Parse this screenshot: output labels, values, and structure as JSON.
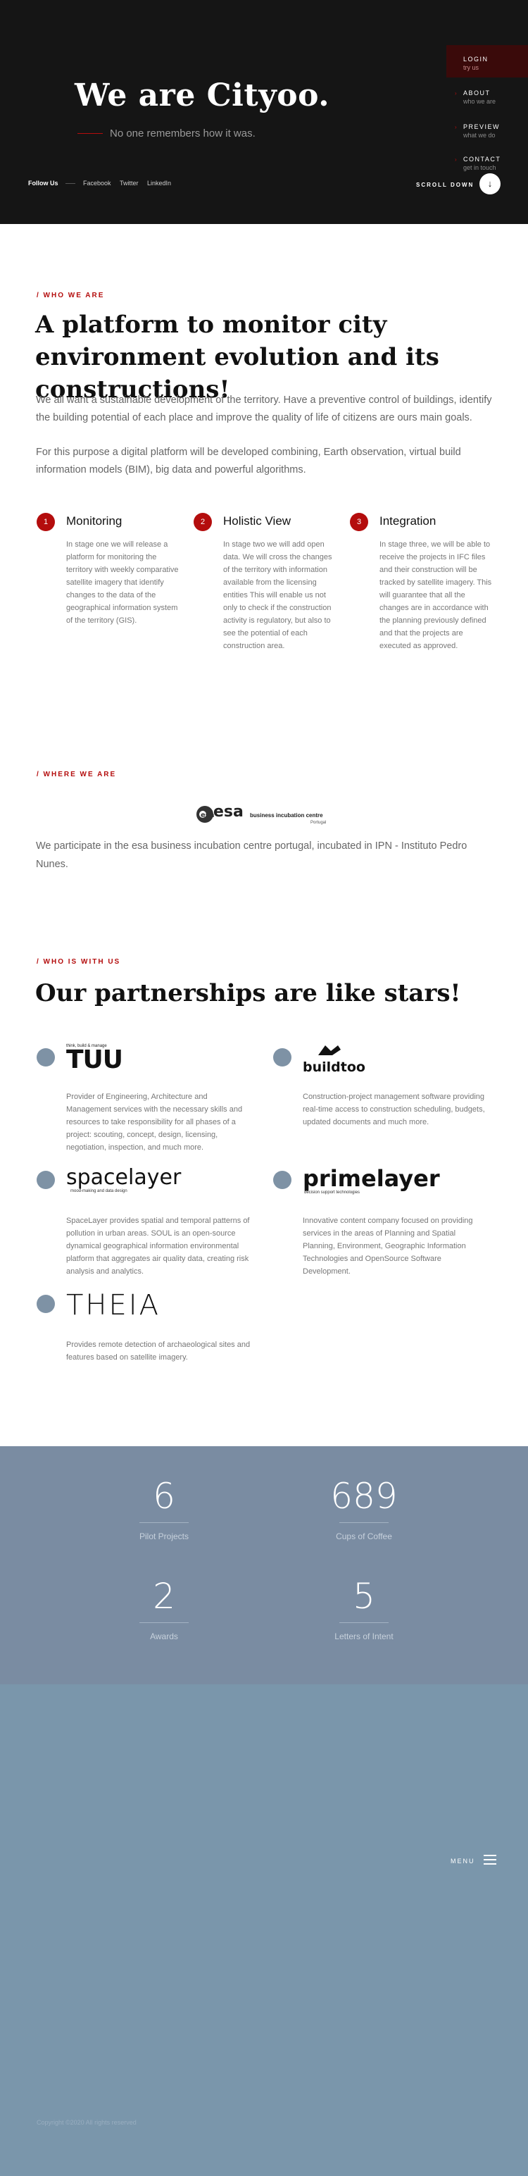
{
  "hero": {
    "title": "We are Cityoo.",
    "subtitle": "No one remembers how it was.",
    "follow_label": "Follow Us",
    "socials": [
      "Facebook",
      "Twitter",
      "LinkedIn"
    ],
    "scroll_label": "SCROLL DOWN",
    "scroll_icon": "↓"
  },
  "nav": [
    {
      "title": "LOGIN",
      "sub": "try us",
      "active": true
    },
    {
      "title": "ABOUT",
      "sub": "who we are",
      "active": false
    },
    {
      "title": "PREVIEW",
      "sub": "what we do",
      "active": false
    },
    {
      "title": "CONTACT",
      "sub": "get in touch",
      "active": false
    }
  ],
  "who": {
    "eyebrow": "/ WHO WE ARE",
    "heading": "A platform to monitor city environment evolution and its constructions!",
    "p1": "We all want a sustainable development of the territory. Have a preventive control of buildings, identify the building potential of each place and improve the quality of life of citizens are ours main goals.",
    "p2": "For this purpose a digital platform will be developed combining, Earth observation, virtual build information models (BIM), big data and powerful algorithms."
  },
  "steps": [
    {
      "num": "1",
      "title": "Monitoring",
      "text": "In stage one we will release a platform for monitoring the territory with weekly comparative satellite imagery that identify changes to the data of the geographical information system of the territory (GIS)."
    },
    {
      "num": "2",
      "title": "Holistic View",
      "text": "In stage two we will add open data. We will cross the changes of the territory with information available from the licensing entities This will enable us not only to check if the construction activity is regulatory, but also to see the potential of each construction area."
    },
    {
      "num": "3",
      "title": "Integration",
      "text": "In stage three, we will be able to receive the projects in IFC files and their construction will be tracked by satellite imagery. This will guarantee that all the changes are in accordance with the planning previously defined and that the projects are executed as approved."
    }
  ],
  "where": {
    "eyebrow": "/ WHERE WE ARE",
    "logo_main": "esa",
    "logo_sub": "business incubation centre",
    "logo_place": "Portugal",
    "text": "We participate in the esa business incubation centre portugal, incubated in IPN - Instituto Pedro Nunes."
  },
  "partners_section": {
    "eyebrow": "/ WHO IS WITH US",
    "heading": "Our partnerships are like stars!"
  },
  "partners": [
    {
      "logo": "TUU",
      "logo_caption": "think, build & manage",
      "text": "Provider of Engineering, Architecture and Management services with the necessary skills and resources to take responsibility for all phases of a project: scouting, concept, design, licensing, negotiation, inspection, and much more."
    },
    {
      "logo": "buildtoo",
      "logo_caption": "",
      "text": "Construction-project management software providing real-time access to construction scheduling, budgets, updated documents and much more."
    },
    {
      "logo": "spacelayer",
      "logo_caption": "mood-making and data design",
      "text": "SpaceLayer provides spatial and temporal patterns of pollution in urban areas. SOUL is an open-source dynamical geographical information environmental platform that aggregates air quality data, creating risk analysis and analytics."
    },
    {
      "logo": "primelayer",
      "logo_caption": "decision support technologies",
      "text": "Innovative content company focused on providing services in the areas of Planning and Spatial Planning, Environment, Geographic Information Technologies and OpenSource Software Development."
    },
    {
      "logo": "THEIA",
      "logo_caption": "",
      "text": "Provides remote detection of archaeological sites and features based on satellite imagery."
    }
  ],
  "stats": [
    {
      "num": "6",
      "label": "Pilot Projects"
    },
    {
      "num": "689",
      "label": "Cups of Coffee"
    },
    {
      "num": "2",
      "label": "Awards"
    },
    {
      "num": "5",
      "label": "Letters of Intent"
    }
  ],
  "footer": {
    "menu_label": "MENU",
    "copyright": "Copyright ©2020 All rights reserved"
  },
  "colors": {
    "accent": "#b40d0d",
    "hero_bg": "#151515",
    "stats_bg": "#7a8ca2",
    "footer_bg": "#7a96ab"
  }
}
